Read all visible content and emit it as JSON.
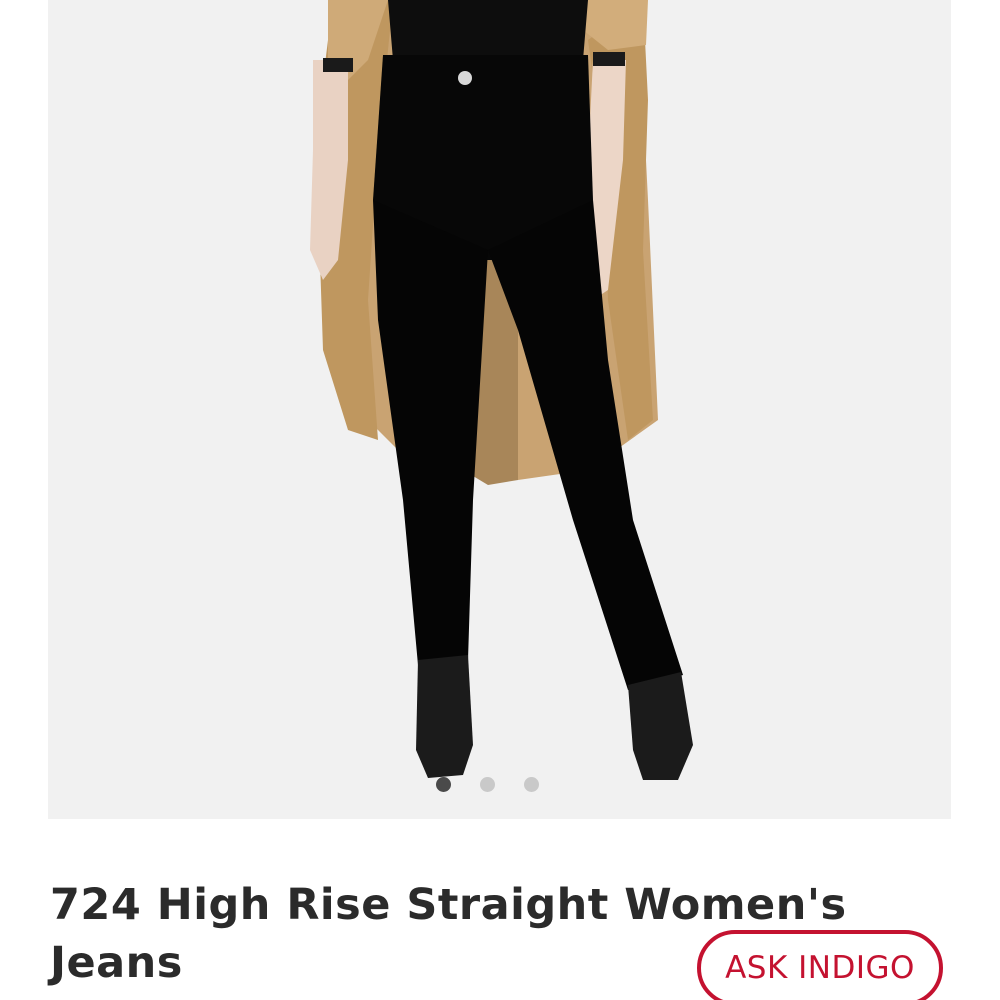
{
  "product": {
    "title": "724 High Rise Straight Women's Jeans",
    "image_description_icon": "product-photo",
    "carousel": {
      "total_slides": 3,
      "active_index": 0
    }
  },
  "assistant": {
    "button_label": "ASK INDIGO",
    "accent_color": "#c41230"
  }
}
